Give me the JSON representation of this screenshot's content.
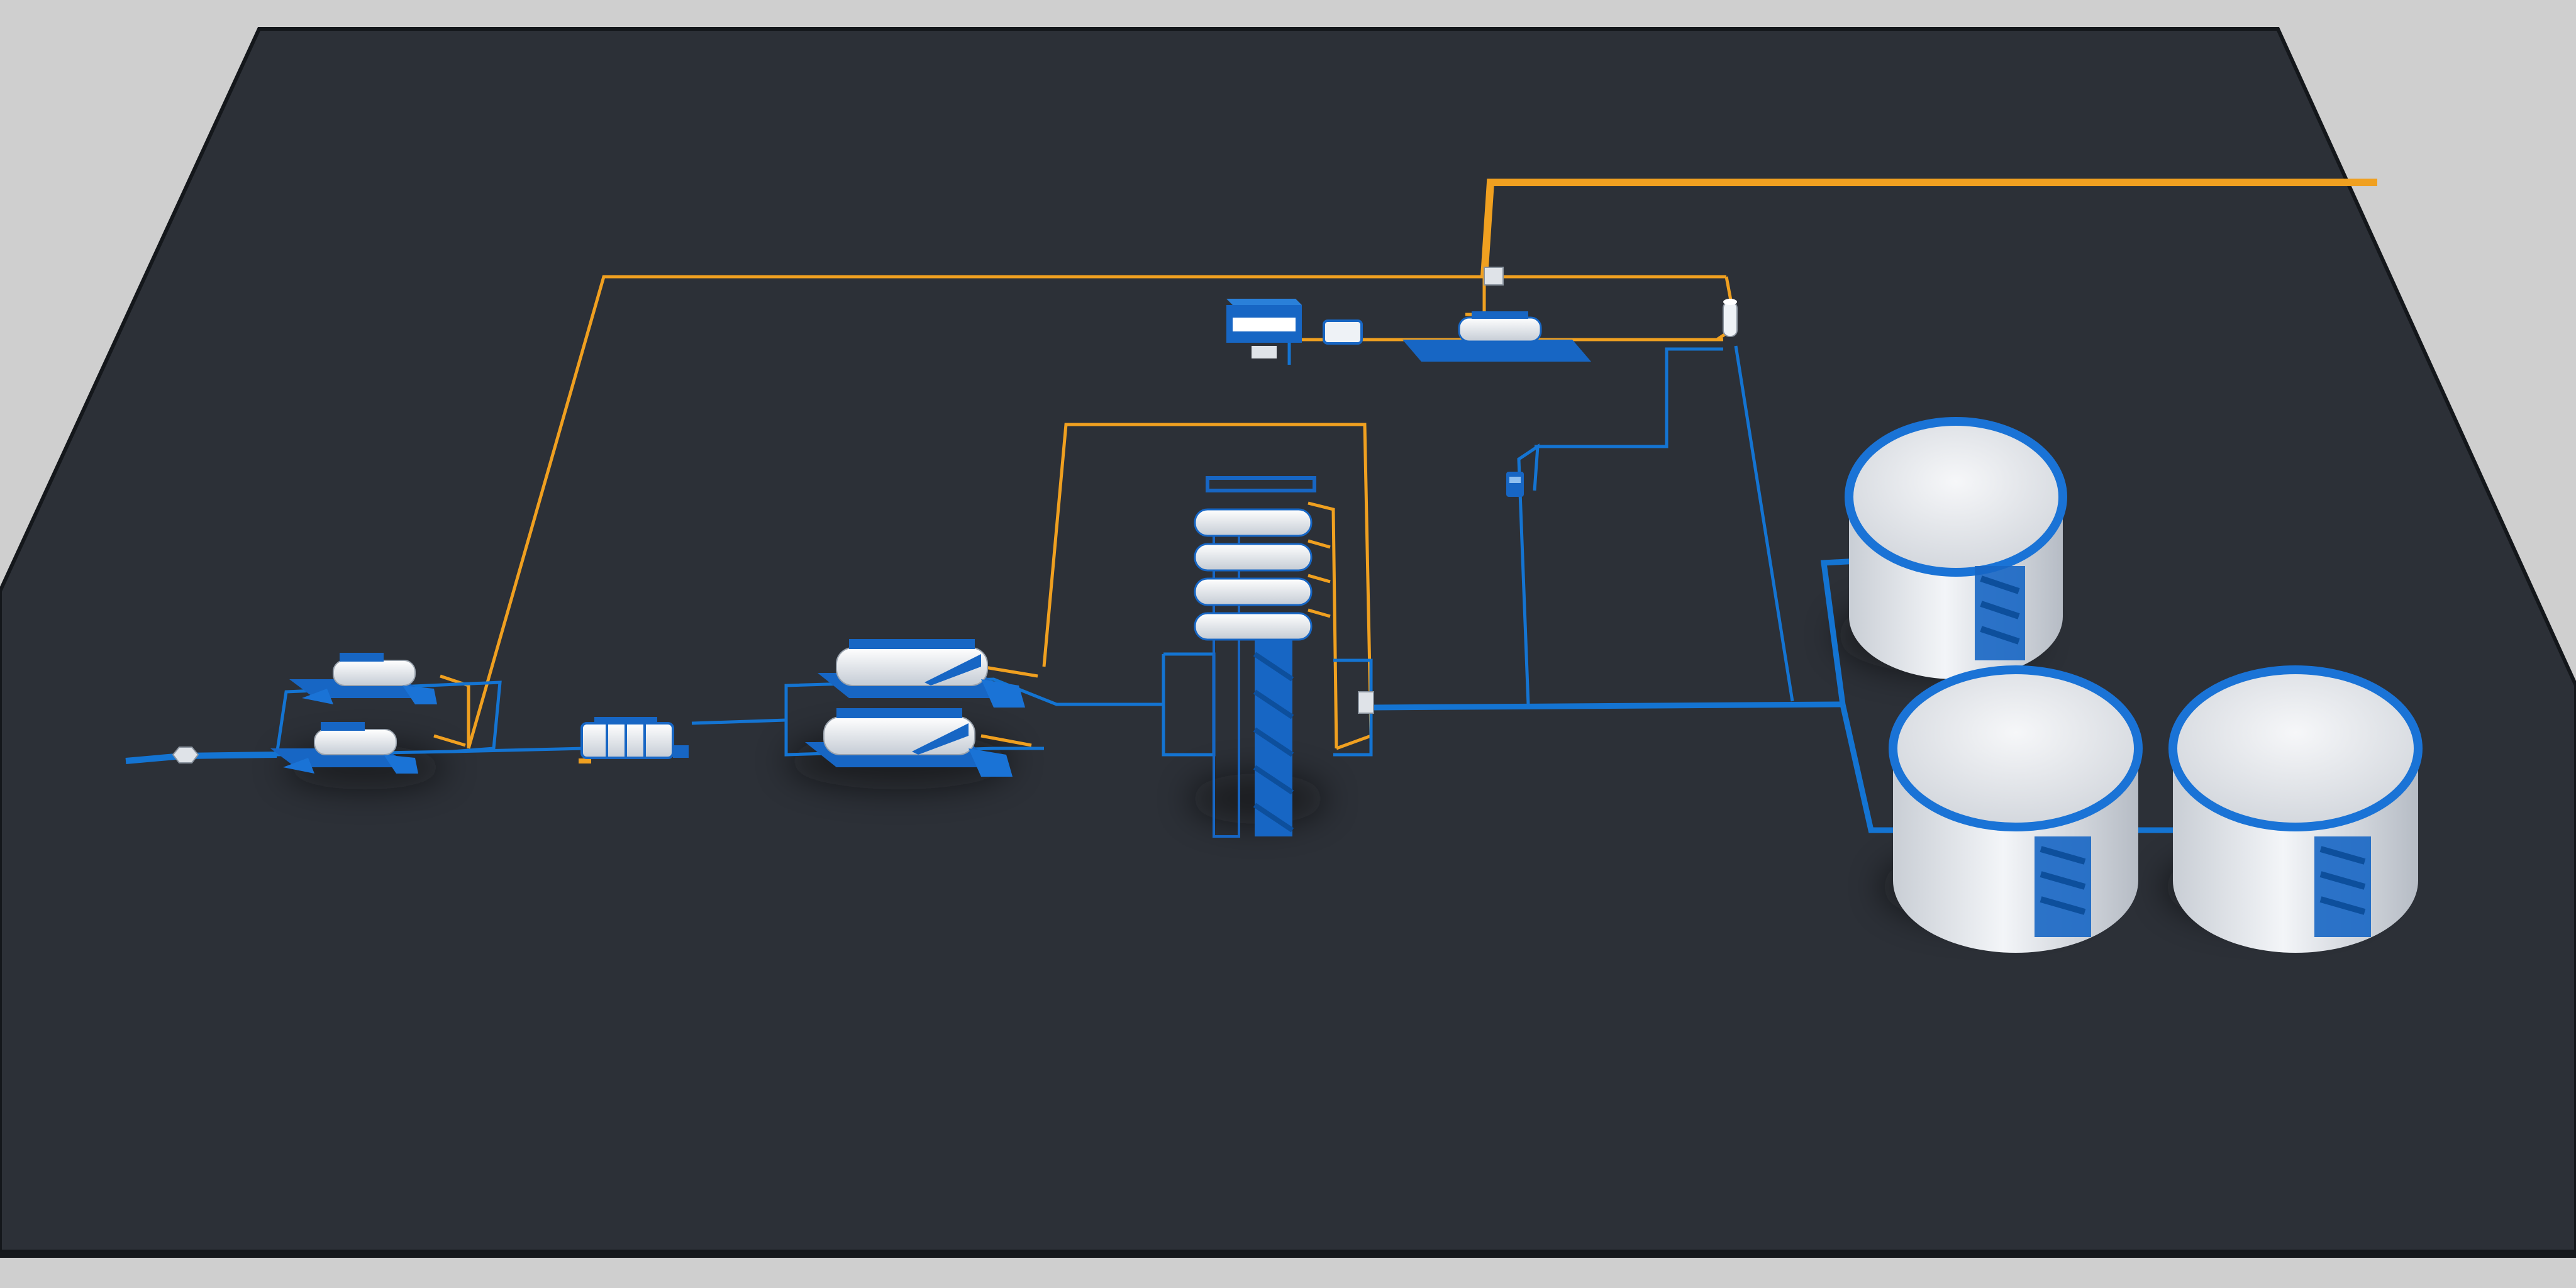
{
  "scene": {
    "kind": "3d-isometric-process-plant",
    "colors": {
      "background": "#cfcfcf",
      "platform": "#2c3037",
      "platform_edge": "#15181c",
      "water_pipe": "#1474d2",
      "gas_pipe": "#f0a020",
      "vessel_white": "#eef2f6",
      "tank_shell": "#dfe3e8",
      "equipment_blue": "#1766c4"
    },
    "icons": [
      "inlet-valve-icon",
      "separator-unit-icon",
      "filter-unit-icon",
      "treater-unit-icon",
      "tower-unit-icon",
      "control-building-icon",
      "compressor-unit-icon",
      "flare-scrubber-icon",
      "pump-icon",
      "storage-tank-icon"
    ]
  }
}
